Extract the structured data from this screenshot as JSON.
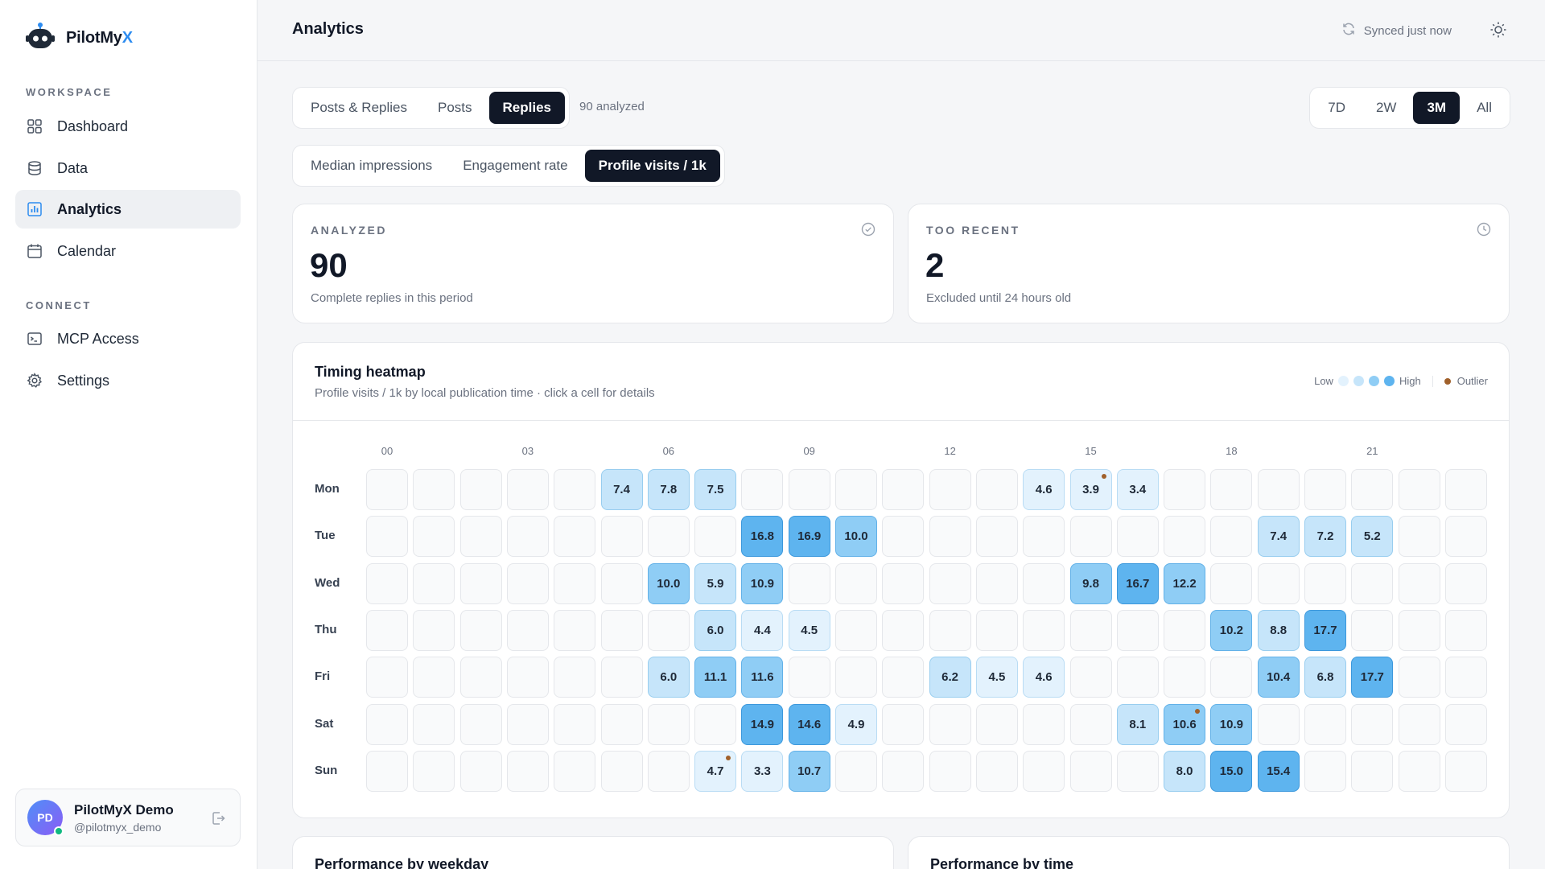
{
  "brand": {
    "name_main": "PilotMy",
    "name_accent": "X"
  },
  "sidebar": {
    "workspace_label": "WORKSPACE",
    "connect_label": "CONNECT",
    "workspace_items": [
      {
        "label": "Dashboard",
        "icon": "grid-icon"
      },
      {
        "label": "Data",
        "icon": "database-icon"
      },
      {
        "label": "Analytics",
        "icon": "chart-icon",
        "active": true
      },
      {
        "label": "Calendar",
        "icon": "calendar-icon"
      }
    ],
    "connect_items": [
      {
        "label": "MCP Access",
        "icon": "terminal-icon"
      },
      {
        "label": "Settings",
        "icon": "gear-icon"
      }
    ]
  },
  "user": {
    "initials": "PD",
    "name": "PilotMyX Demo",
    "handle": "@pilotmyx_demo"
  },
  "header": {
    "title": "Analytics",
    "sync_status": "Synced just now"
  },
  "content_tabs": {
    "options": [
      "Posts & Replies",
      "Posts",
      "Replies"
    ],
    "selected": "Replies",
    "note": "90 analyzed"
  },
  "range_tabs": {
    "options": [
      "7D",
      "2W",
      "3M",
      "All"
    ],
    "selected": "3M"
  },
  "metric_tabs": {
    "options": [
      "Median impressions",
      "Engagement rate",
      "Profile visits / 1k"
    ],
    "selected": "Profile visits / 1k"
  },
  "stats": {
    "analyzed": {
      "label": "ANALYZED",
      "value": "90",
      "sub": "Complete replies in this period"
    },
    "too_recent": {
      "label": "TOO RECENT",
      "value": "2",
      "sub": "Excluded until 24 hours old"
    }
  },
  "heatmap": {
    "title": "Timing heatmap",
    "subtitle": "Profile visits / 1k by local publication time · click a cell for details",
    "legend": {
      "low": "Low",
      "high": "High",
      "outlier": "Outlier"
    },
    "colors": {
      "empty": "#f9fafb",
      "level1": "#e3f2fd",
      "level2": "#c6e5fa",
      "level3": "#8fcdf5",
      "level4": "#5eb4ef",
      "outlier": "#a0602a"
    },
    "hour_labels": [
      "00",
      "03",
      "06",
      "09",
      "12",
      "15",
      "18",
      "21"
    ],
    "days": [
      "Mon",
      "Tue",
      "Wed",
      "Thu",
      "Fri",
      "Sat",
      "Sun"
    ]
  },
  "chart_data": {
    "type": "heatmap",
    "title": "Timing heatmap",
    "x": [
      "00",
      "01",
      "02",
      "03",
      "04",
      "05",
      "06",
      "07",
      "08",
      "09",
      "10",
      "11",
      "12",
      "13",
      "14",
      "15",
      "16",
      "17",
      "18",
      "19",
      "20",
      "21",
      "22",
      "23"
    ],
    "y": [
      "Mon",
      "Tue",
      "Wed",
      "Thu",
      "Fri",
      "Sat",
      "Sun"
    ],
    "values": [
      [
        null,
        null,
        null,
        null,
        null,
        7.4,
        7.8,
        7.5,
        null,
        null,
        null,
        null,
        null,
        null,
        4.6,
        3.9,
        3.4,
        null,
        null,
        null,
        null,
        null,
        null,
        null
      ],
      [
        null,
        null,
        null,
        null,
        null,
        null,
        null,
        null,
        16.8,
        16.9,
        10.0,
        null,
        null,
        null,
        null,
        null,
        null,
        null,
        null,
        7.4,
        7.2,
        5.2,
        null,
        null
      ],
      [
        null,
        null,
        null,
        null,
        null,
        null,
        10.0,
        5.9,
        10.9,
        null,
        null,
        null,
        null,
        null,
        null,
        9.8,
        16.7,
        12.2,
        null,
        null,
        null,
        null,
        null,
        null
      ],
      [
        null,
        null,
        null,
        null,
        null,
        null,
        null,
        6.0,
        4.4,
        4.5,
        null,
        null,
        null,
        null,
        null,
        null,
        null,
        null,
        10.2,
        8.8,
        17.7,
        null,
        null,
        null
      ],
      [
        null,
        null,
        null,
        null,
        null,
        null,
        6.0,
        11.1,
        11.6,
        null,
        null,
        null,
        6.2,
        4.5,
        4.6,
        null,
        null,
        null,
        null,
        10.4,
        6.8,
        17.7,
        null,
        null
      ],
      [
        null,
        null,
        null,
        null,
        null,
        null,
        null,
        null,
        14.9,
        14.6,
        4.9,
        null,
        null,
        null,
        null,
        null,
        8.1,
        10.6,
        10.9,
        null,
        null,
        null,
        null,
        null
      ],
      [
        null,
        null,
        null,
        null,
        null,
        null,
        null,
        4.7,
        3.3,
        10.7,
        null,
        null,
        null,
        null,
        null,
        null,
        null,
        8.0,
        15.0,
        15.4,
        null,
        null,
        null,
        null
      ]
    ],
    "outliers": [
      [
        "Mon",
        "15"
      ],
      [
        "Sat",
        "17"
      ],
      [
        "Sun",
        "07"
      ]
    ]
  },
  "bottom_cards": {
    "weekday_title": "Performance by weekday",
    "time_title": "Performance by time"
  }
}
